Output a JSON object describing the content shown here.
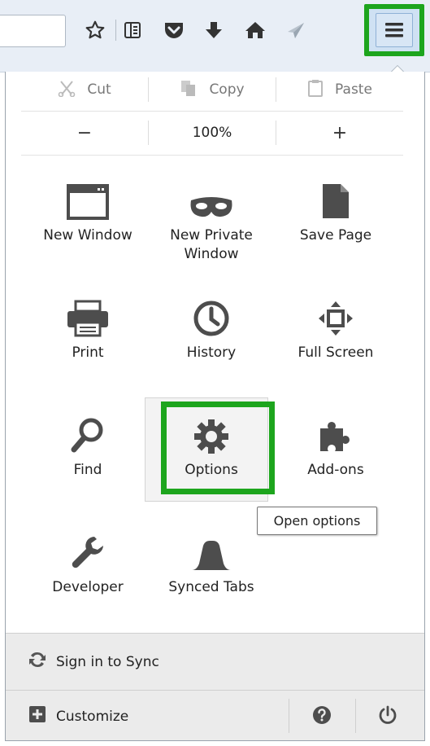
{
  "toolbar": {
    "icons": [
      "bookmark-star-icon",
      "reading-list-icon",
      "pocket-icon",
      "download-icon",
      "home-icon",
      "share-icon",
      "hamburger-menu-icon"
    ]
  },
  "edit": {
    "cut": "Cut",
    "copy": "Copy",
    "paste": "Paste"
  },
  "zoom": {
    "minus": "−",
    "level": "100%",
    "plus": "+"
  },
  "grid": {
    "new_window": "New Window",
    "new_private_line1": "New Private",
    "new_private_line2": "Window",
    "save_page": "Save Page",
    "print": "Print",
    "history": "History",
    "full_screen": "Full Screen",
    "find": "Find",
    "options": "Options",
    "addons": "Add-ons",
    "developer": "Developer",
    "synced_tabs": "Synced Tabs"
  },
  "tooltip": "Open options",
  "footer": {
    "sync": "Sign in to Sync",
    "customize": "Customize"
  },
  "colors": {
    "highlight_green": "#1da51d",
    "icon_gray": "#4d4d4d"
  }
}
